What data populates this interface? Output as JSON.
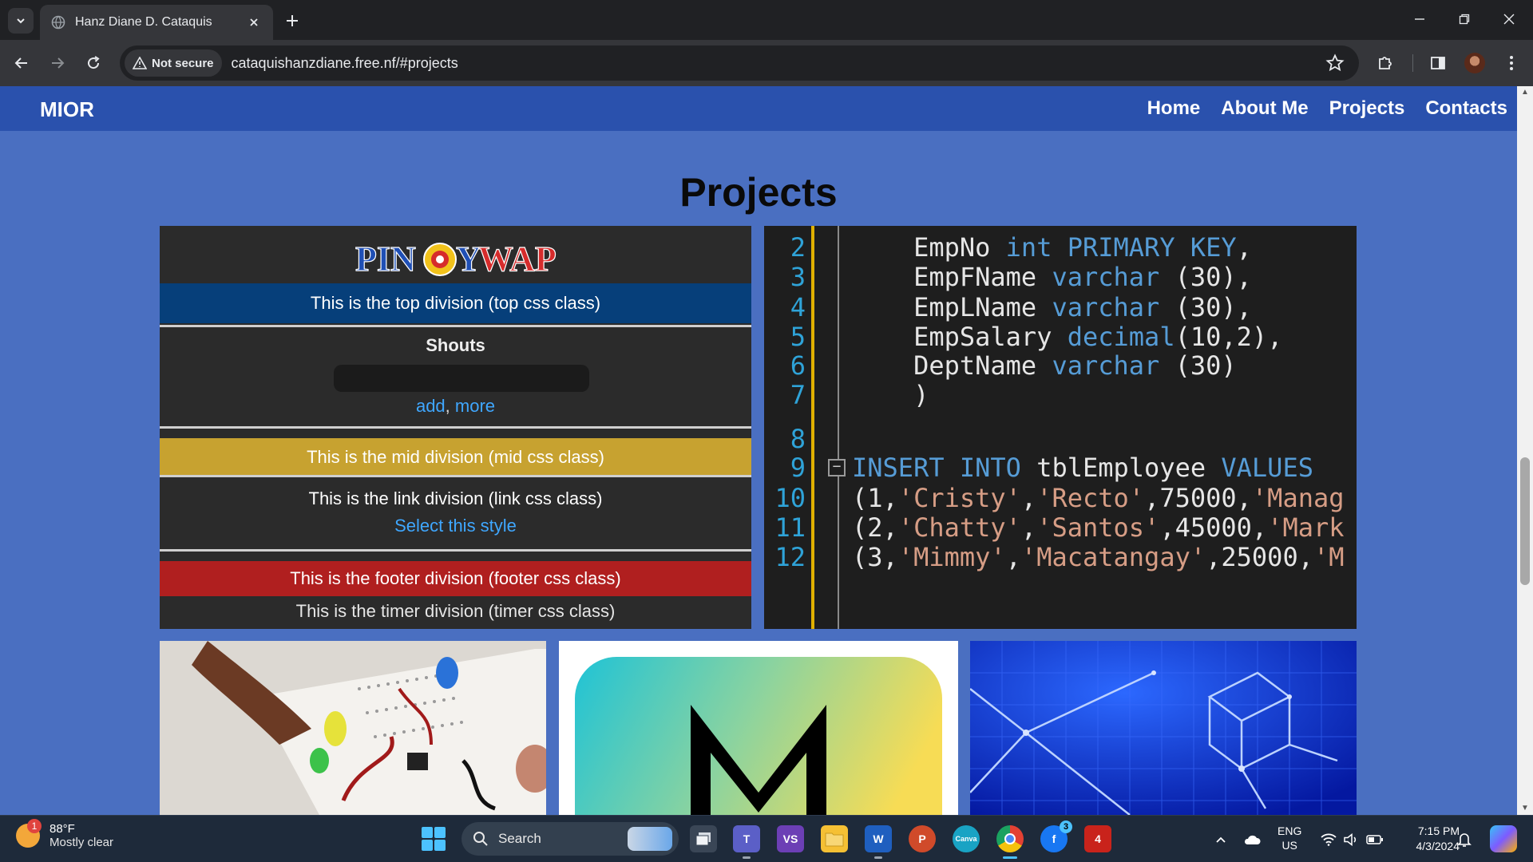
{
  "browser": {
    "tab_title": "Hanz Diane D. Cataquis",
    "security_label": "Not secure",
    "url": "cataquishanzdiane.free.nf/#projects"
  },
  "site": {
    "brand": "MIOR",
    "nav": [
      "Home",
      "About Me",
      "Projects",
      "Contacts"
    ],
    "projects_heading": "Projects"
  },
  "theme_preview": {
    "logo_text": "PINOYWAP",
    "top_band": "This is the top division (top css class)",
    "shouts_title": "Shouts",
    "shouts_add": "add",
    "shouts_comma": ",",
    "shouts_more": "more",
    "mid_band": "This is the mid division (mid css class)",
    "link_band": "This is the link division (link css class)",
    "link_select": "Select this style",
    "footer_band": "This is the footer division (footer css class)",
    "timer_band": "This is the timer division (timer css class)"
  },
  "code_sample": {
    "lines": [
      {
        "n": "2",
        "tokens": [
          [
            "",
            "    EmpNo "
          ],
          [
            "kw",
            "int PRIMARY KEY"
          ],
          [
            "",
            ","
          ]
        ]
      },
      {
        "n": "3",
        "tokens": [
          [
            "",
            "    EmpFName "
          ],
          [
            "kw",
            "varchar"
          ],
          [
            "",
            " (30),"
          ]
        ]
      },
      {
        "n": "4",
        "tokens": [
          [
            "",
            "    EmpLName "
          ],
          [
            "kw",
            "varchar"
          ],
          [
            "",
            " (30),"
          ]
        ]
      },
      {
        "n": "5",
        "tokens": [
          [
            "",
            "    EmpSalary "
          ],
          [
            "kw",
            "decimal"
          ],
          [
            "",
            "(10,2),"
          ]
        ]
      },
      {
        "n": "6",
        "tokens": [
          [
            "",
            "    DeptName "
          ],
          [
            "kw",
            "varchar"
          ],
          [
            "",
            " (30)"
          ]
        ]
      },
      {
        "n": "7",
        "tokens": [
          [
            "",
            "    )"
          ]
        ]
      },
      {
        "n": "8",
        "tokens": [
          [
            "",
            ""
          ]
        ]
      },
      {
        "n": "9",
        "tokens": [
          [
            "kw",
            "INSERT INTO"
          ],
          [
            "",
            " tblEmployee "
          ],
          [
            "kw",
            "VALUES"
          ]
        ]
      },
      {
        "n": "10",
        "tokens": [
          [
            "",
            "(1,"
          ],
          [
            "str",
            "'Cristy'"
          ],
          [
            "",
            ","
          ],
          [
            "str",
            "'Recto'"
          ],
          [
            "",
            ",75000,"
          ],
          [
            "str",
            "'Manag"
          ]
        ]
      },
      {
        "n": "11",
        "tokens": [
          [
            "",
            "(2,"
          ],
          [
            "str",
            "'Chatty'"
          ],
          [
            "",
            ","
          ],
          [
            "str",
            "'Santos'"
          ],
          [
            "",
            ",45000,"
          ],
          [
            "str",
            "'Mark"
          ]
        ]
      },
      {
        "n": "12",
        "tokens": [
          [
            "",
            "(3,"
          ],
          [
            "str",
            "'Mimmy'"
          ],
          [
            "",
            ","
          ],
          [
            "str",
            "'Macatangay'"
          ],
          [
            "",
            ",25000,"
          ],
          [
            "str",
            "'M"
          ]
        ]
      }
    ]
  },
  "taskbar": {
    "weather_badge": "1",
    "temperature": "88°F",
    "weather_desc": "Mostly clear",
    "search_label": "Search",
    "messenger_count": "3",
    "lang_top": "ENG",
    "lang_bottom": "US",
    "time": "7:15 PM",
    "date": "4/3/2024"
  },
  "colors": {
    "page_bg": "#4a6fc1",
    "nav_bg": "#2a51ad",
    "top_band": "#063f7a",
    "mid_band": "#c7a230",
    "footer_band": "#b01f1f",
    "link_blue": "#3fa7ff"
  }
}
